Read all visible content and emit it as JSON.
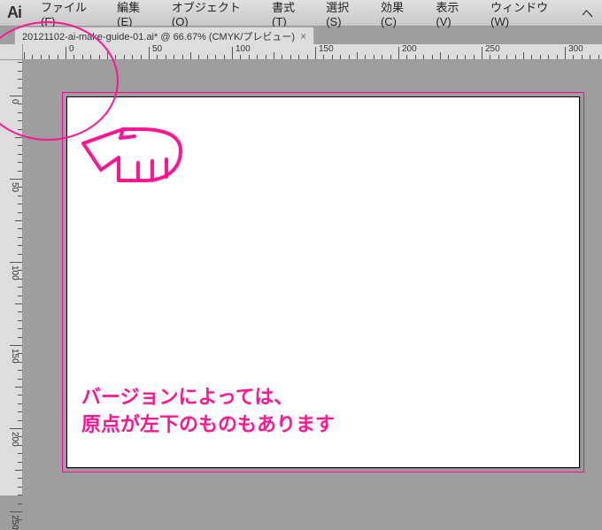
{
  "app": {
    "logo_text": "Ai"
  },
  "menu": {
    "file": "ファイル(F)",
    "edit": "編集(E)",
    "object": "オブジェクト(O)",
    "type": "書式(T)",
    "select": "選択(S)",
    "effect": "効果(C)",
    "view": "表示(V)",
    "window": "ウィンドウ(W)",
    "help": "ヘ"
  },
  "tab": {
    "title": "20121102-ai-make-guide-01.ai* @ 66.67% (CMYK/プレビュー)",
    "close": "×"
  },
  "ruler_h": {
    "0": "0",
    "50": "50",
    "100": "100",
    "150": "150",
    "200": "200",
    "250": "250",
    "300": "300"
  },
  "ruler_v": {
    "0": "0",
    "50": "50",
    "100": "100",
    "150": "150",
    "200": "200",
    "250": "250"
  },
  "annotation": {
    "line1": "バージョンによっては、",
    "line2": "原点が左下のものもあります"
  }
}
